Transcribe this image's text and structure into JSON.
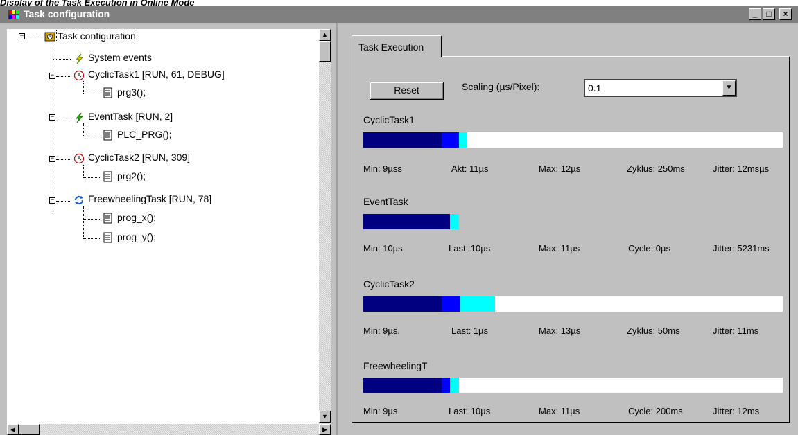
{
  "caption": "Display of the Task Execution in Online Mode",
  "window": {
    "title": "Task configuration",
    "min_glyph": "_",
    "max_glyph": "□",
    "close_glyph": "×"
  },
  "tree": {
    "root": "Task configuration",
    "items": [
      {
        "label": "System events"
      },
      {
        "label": "CyclicTask1 [RUN, 61, DEBUG]"
      },
      {
        "label": "prg3();"
      },
      {
        "label": "EventTask [RUN, 2]"
      },
      {
        "label": "PLC_PRG();"
      },
      {
        "label": "CyclicTask2 [RUN, 309]"
      },
      {
        "label": "prg2();"
      },
      {
        "label": "FreewheelingTask [RUN, 78]"
      },
      {
        "label": "prog_x();"
      },
      {
        "label": "prog_y();"
      }
    ]
  },
  "tab": {
    "label": "Task Execution"
  },
  "controls": {
    "reset_label": "Reset",
    "scaling_label": "Scaling (µs/Pixel):",
    "scaling_value": "0.1"
  },
  "colors": {
    "min": "#000080",
    "current": "#0000ff",
    "max": "#00ffff"
  },
  "tasks": [
    {
      "name": "CyclicTask1",
      "stats": [
        "Min: 9µss",
        "Akt: 11µs",
        "Max: 12µs",
        "Zyklus: 250ms",
        "Jitter: 12msµs"
      ],
      "min_us": 9,
      "cur_us": 11,
      "max_us": 12
    },
    {
      "name": "EventTask",
      "stats": [
        "Min: 10µs",
        "Last: 10µs",
        "Max: 11µs",
        "Cycle: 0µs",
        "Jitter: 5231ms"
      ],
      "min_us": 10,
      "cur_us": 10,
      "max_us": 11
    },
    {
      "name": "CyclicTask2",
      "stats": [
        "Min: 9µs.",
        "Last: 1µs",
        "Max: 13µs",
        "Zyklus: 50ms",
        "Jitter: 11ms"
      ],
      "min_us": 9,
      "cur_us": 1,
      "max_us": 13
    },
    {
      "name": "FreewheelingT",
      "stats": [
        "Min: 9µs",
        "Last: 10µs",
        "Max: 11µs",
        "Cycle: 200ms",
        "Jitter: 12ms"
      ],
      "min_us": 9,
      "cur_us": 10,
      "max_us": 11
    }
  ]
}
